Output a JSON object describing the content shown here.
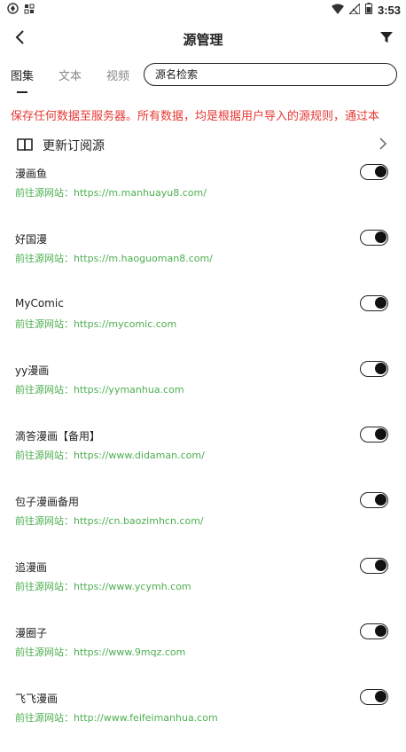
{
  "status_bar": {
    "time": "3:53"
  },
  "header": {
    "title": "源管理"
  },
  "tabs": [
    {
      "label": "图集",
      "active": true
    },
    {
      "label": "文本",
      "active": false
    },
    {
      "label": "视频",
      "active": false
    }
  ],
  "search": {
    "placeholder": "源名检索"
  },
  "warning_text": "保存任何数据至服务器。所有数据，均是根据用户导入的源规则，通过本",
  "subscription": {
    "label": "更新订阅源"
  },
  "sources": [
    {
      "name": "漫画鱼",
      "link": "前往源网站：https://m.manhuayu8.com/",
      "enabled": true
    },
    {
      "name": "好国漫",
      "link": "前往源网站：https://m.haoguoman8.com/",
      "enabled": true
    },
    {
      "name": "MyComic",
      "link": "前往源网站：https://mycomic.com",
      "enabled": true
    },
    {
      "name": "yy漫画",
      "link": "前往源网站：https://yymanhua.com",
      "enabled": true
    },
    {
      "name": "滴答漫画【备用】",
      "link": "前往源网站：https://www.didaman.com/",
      "enabled": true
    },
    {
      "name": "包子漫画备用",
      "link": "前往源网站：https://cn.baozimhcn.com/",
      "enabled": true
    },
    {
      "name": "追漫画",
      "link": "前往源网站：https://www.ycymh.com",
      "enabled": true
    },
    {
      "name": "漫圈子",
      "link": "前往源网站：https://www.9mqz.com",
      "enabled": true
    },
    {
      "name": "飞飞漫画",
      "link": "前往源网站：http://www.feifeimanhua.com",
      "enabled": true
    }
  ],
  "colors": {
    "warning": "#e53935",
    "link": "#4caf50",
    "text": "#222222"
  }
}
